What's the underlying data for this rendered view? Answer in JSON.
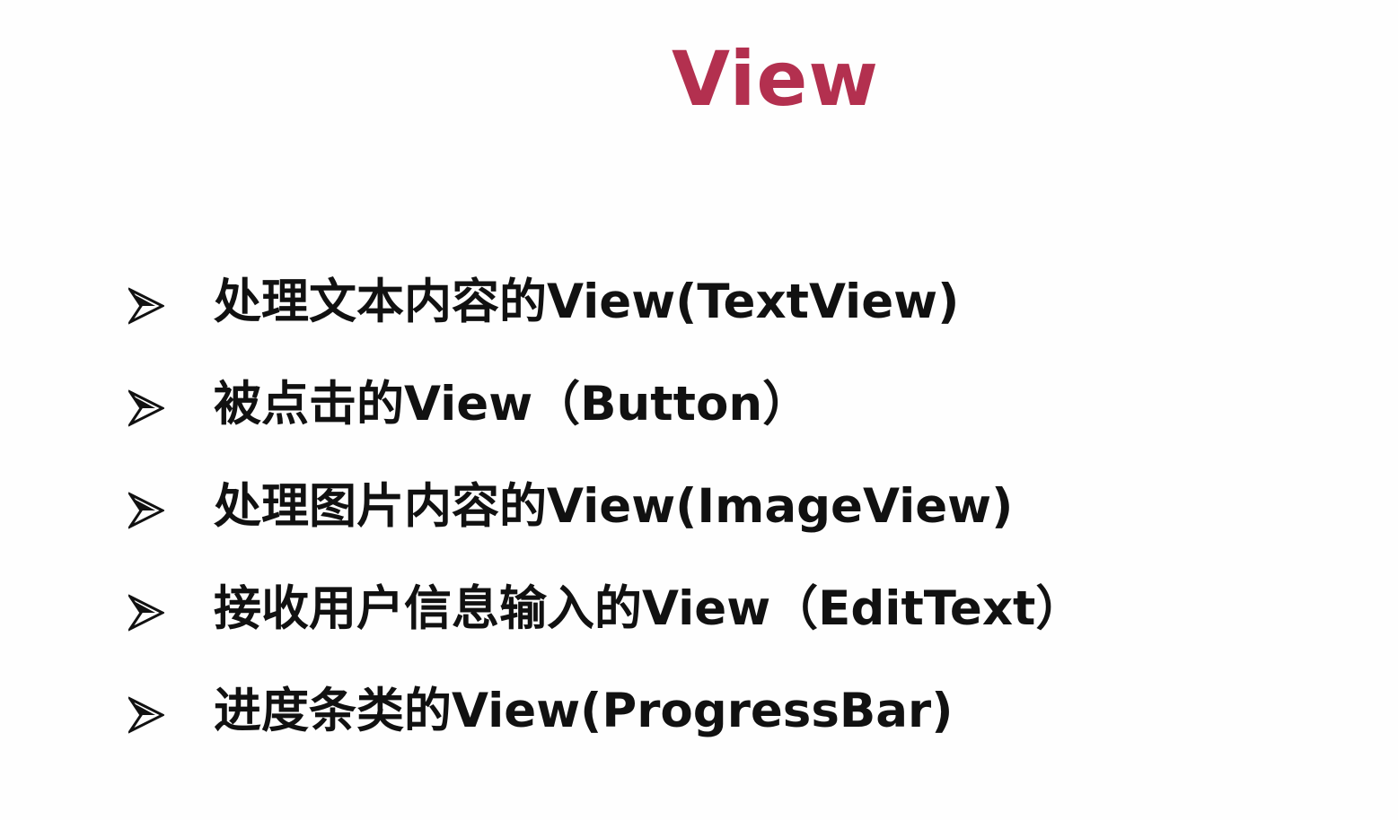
{
  "slide": {
    "title": "View",
    "title_color": "#b3304f",
    "text_color": "#111111",
    "bullet_icon": "arrowhead-bullet-icon",
    "bullets": [
      {
        "text": "处理文本内容的View(TextView)"
      },
      {
        "text": "被点击的View（Button）"
      },
      {
        "text": "处理图片内容的View(ImageView)"
      },
      {
        "text": "接收用户信息输入的View（EditText）"
      },
      {
        "text": "进度条类的View(ProgressBar)"
      }
    ]
  }
}
